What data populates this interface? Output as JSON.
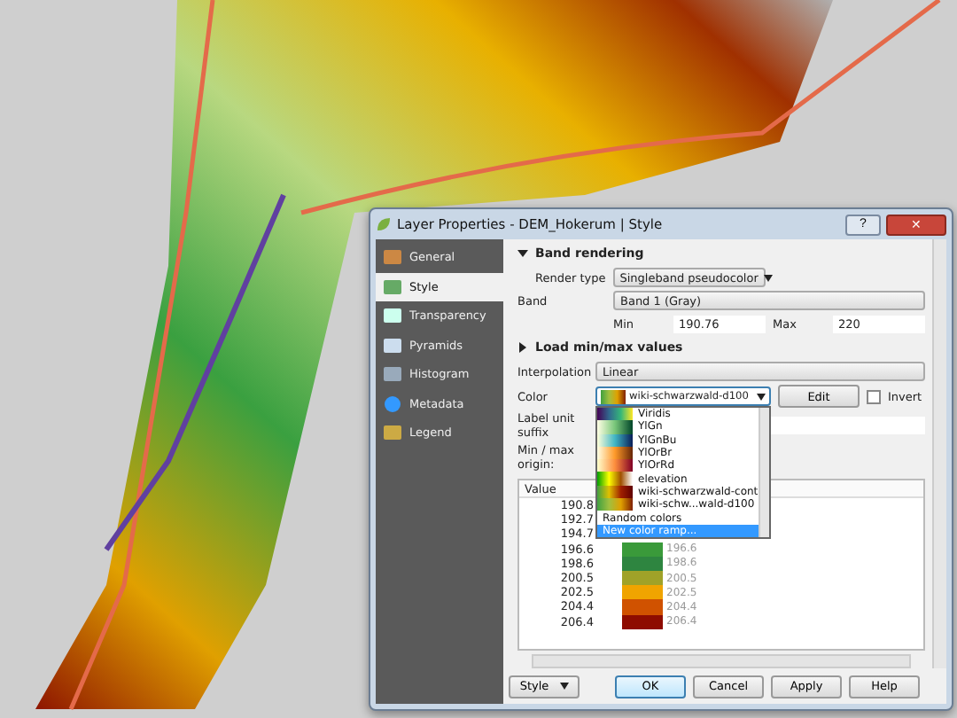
{
  "window": {
    "title": "Layer Properties - DEM_Hokerum | Style",
    "help_button": "?",
    "close_button": "✕"
  },
  "sidebar": {
    "items": [
      {
        "label": "General",
        "selected": false
      },
      {
        "label": "Style",
        "selected": true
      },
      {
        "label": "Transparency",
        "selected": false
      },
      {
        "label": "Pyramids",
        "selected": false
      },
      {
        "label": "Histogram",
        "selected": false
      },
      {
        "label": "Metadata",
        "selected": false
      },
      {
        "label": "Legend",
        "selected": false
      }
    ]
  },
  "band_rendering": {
    "header": "Band rendering",
    "expanded": true,
    "render_type": {
      "label": "Render type",
      "value": "Singleband pseudocolor"
    },
    "band": {
      "label": "Band",
      "value": "Band 1 (Gray)"
    },
    "min": {
      "label": "Min",
      "value": "190.76"
    },
    "max": {
      "label": "Max",
      "value": "220"
    }
  },
  "load_minmax": {
    "header": "Load min/max values",
    "expanded": false
  },
  "interpolation": {
    "label": "Interpolation",
    "value": "Linear"
  },
  "color": {
    "label": "Color",
    "value": "wiki-schwarzwald-d100",
    "edit_button": "Edit",
    "invert": {
      "label": "Invert",
      "checked": false
    }
  },
  "label_unit_suffix": {
    "label": "Label unit suffix"
  },
  "min_max_origin": {
    "label": "Min / max origin:"
  },
  "ramp_dropdown": {
    "items": [
      {
        "label": "Viridis",
        "kind": "ramp",
        "selected": false
      },
      {
        "label": "YlGn",
        "kind": "ramp",
        "selected": false
      },
      {
        "label": "YlGnBu",
        "kind": "ramp",
        "selected": false
      },
      {
        "label": "YlOrBr",
        "kind": "ramp",
        "selected": false
      },
      {
        "label": "YlOrRd",
        "kind": "ramp",
        "selected": false
      },
      {
        "label": "elevation",
        "kind": "ramp",
        "selected": false
      },
      {
        "label": "wiki-schwarzwald-cont",
        "kind": "ramp",
        "selected": false
      },
      {
        "label": "wiki-schw...wald-d100",
        "kind": "ramp",
        "selected": false
      },
      {
        "label": "Random colors",
        "kind": "plain",
        "selected": false
      },
      {
        "label": "New color ramp...",
        "kind": "plain",
        "selected": true
      }
    ]
  },
  "table": {
    "columns": [
      "Value"
    ],
    "rows": [
      {
        "value": "190.8"
      },
      {
        "value": "192.7"
      },
      {
        "value": "194.7"
      },
      {
        "value": "196.6",
        "color": "#3a9a3a",
        "label": "196.6"
      },
      {
        "value": "198.6",
        "color": "#2e8540",
        "label": "198.6"
      },
      {
        "value": "200.5",
        "color": "#a0a228",
        "label": "200.5"
      },
      {
        "value": "202.5",
        "color": "#f0a400",
        "label": "202.5"
      },
      {
        "value": "204.4",
        "color": "#d05200",
        "label": "204.4"
      },
      {
        "value": "206.4",
        "color": "#8e0c00",
        "label": "206.4"
      }
    ]
  },
  "buttons": [
    {
      "label": "Style",
      "kind": "menu"
    },
    {
      "label": "OK",
      "kind": "default"
    },
    {
      "label": "Cancel",
      "kind": "plain"
    },
    {
      "label": "Apply",
      "kind": "plain"
    },
    {
      "label": "Help",
      "kind": "plain"
    }
  ]
}
